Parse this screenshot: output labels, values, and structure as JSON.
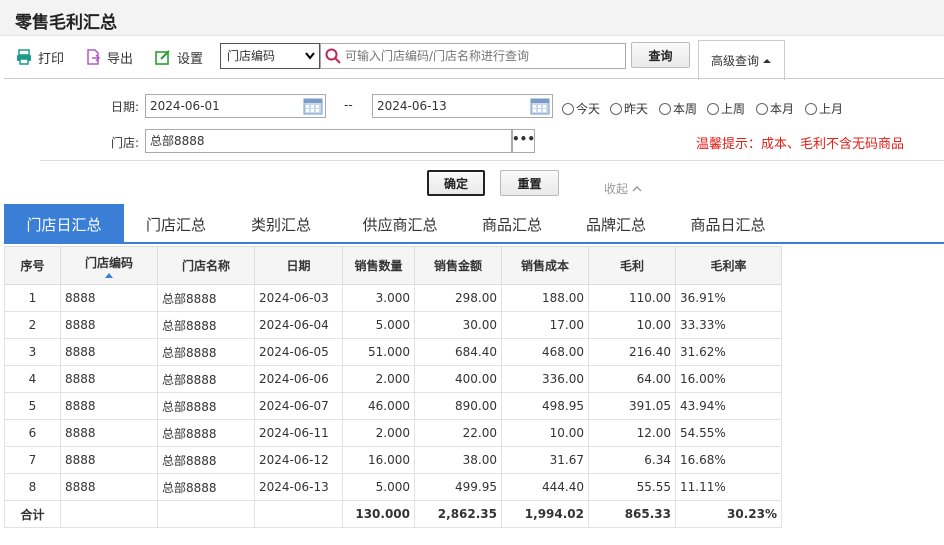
{
  "page": {
    "title": "零售毛利汇总"
  },
  "toolbar": {
    "print": "打印",
    "export": "导出",
    "settings": "设置",
    "field_select": "门店编码",
    "search_placeholder": "可输入门店编码/门店名称进行查询",
    "query": "查询",
    "advanced": "高级查询"
  },
  "filters": {
    "date_label": "日期:",
    "date_from": "2024-06-01",
    "date_sep": "--",
    "date_to": "2024-06-13",
    "quick": [
      "今天",
      "昨天",
      "本周",
      "上周",
      "本月",
      "上月"
    ],
    "store_label": "门店:",
    "store_value": "总部8888",
    "more": "•••",
    "tip": "温馨提示：成本、毛利不含无码商品",
    "confirm": "确定",
    "reset": "重置",
    "collapse": "收起"
  },
  "tabs": [
    "门店日汇总",
    "门店汇总",
    "类别汇总",
    "供应商汇总",
    "商品汇总",
    "品牌汇总",
    "商品日汇总"
  ],
  "table": {
    "headers": [
      "序号",
      "门店编码",
      "门店名称",
      "日期",
      "销售数量",
      "销售金额",
      "销售成本",
      "毛利",
      "毛利率"
    ],
    "rows": [
      [
        "1",
        "8888",
        "总部8888",
        "2024-06-03",
        "3.000",
        "298.00",
        "188.00",
        "110.00",
        "36.91%"
      ],
      [
        "2",
        "8888",
        "总部8888",
        "2024-06-04",
        "5.000",
        "30.00",
        "17.00",
        "10.00",
        "33.33%"
      ],
      [
        "3",
        "8888",
        "总部8888",
        "2024-06-05",
        "51.000",
        "684.40",
        "468.00",
        "216.40",
        "31.62%"
      ],
      [
        "4",
        "8888",
        "总部8888",
        "2024-06-06",
        "2.000",
        "400.00",
        "336.00",
        "64.00",
        "16.00%"
      ],
      [
        "5",
        "8888",
        "总部8888",
        "2024-06-07",
        "46.000",
        "890.00",
        "498.95",
        "391.05",
        "43.94%"
      ],
      [
        "6",
        "8888",
        "总部8888",
        "2024-06-11",
        "2.000",
        "22.00",
        "10.00",
        "12.00",
        "54.55%"
      ],
      [
        "7",
        "8888",
        "总部8888",
        "2024-06-12",
        "16.000",
        "38.00",
        "31.67",
        "6.34",
        "16.68%"
      ],
      [
        "8",
        "8888",
        "总部8888",
        "2024-06-13",
        "5.000",
        "499.95",
        "444.40",
        "55.55",
        "11.11%"
      ]
    ],
    "total": [
      "合计",
      "",
      "",
      "",
      "130.000",
      "2,862.35",
      "1,994.02",
      "865.33",
      "30.23%"
    ]
  },
  "colors": {
    "accent": "#3a7fd5",
    "warning": "#e0201a"
  }
}
